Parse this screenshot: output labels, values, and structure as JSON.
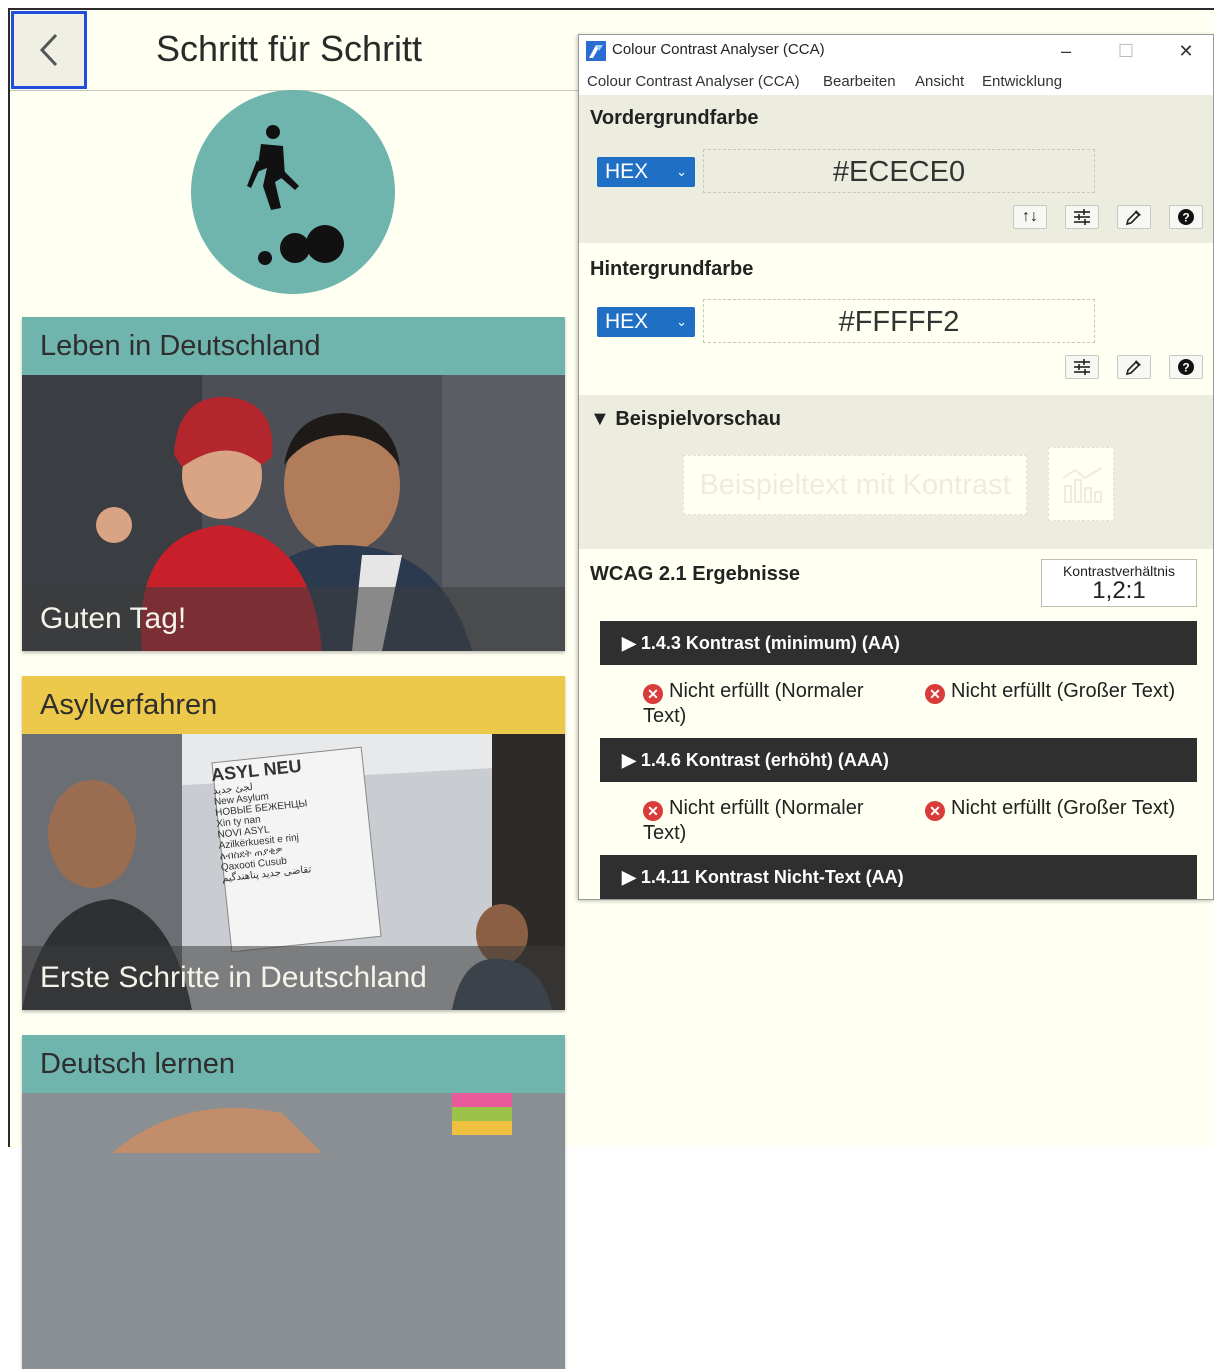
{
  "app": {
    "title": "Schritt für Schritt",
    "cards": [
      {
        "heading": "Leben in Deutschland",
        "caption": "Guten Tag!",
        "color": "#6fb5ad"
      },
      {
        "heading": "Asylverfahren",
        "caption": "Erste Schritte in Deutschland",
        "color": "#ecc94a"
      },
      {
        "heading": "Deutsch lernen",
        "caption": "",
        "color": "#6fb5ad"
      }
    ],
    "sign_lines": [
      "ASYL NEU",
      "لجئ جديد",
      "New Asylum",
      "НОВЫЕ БЕЖЕНЦЫ",
      "Xin ty nan",
      "NOVI ASYL",
      "Azilkërkuesit e rinj",
      "ለብስደት ጠያቂዎ",
      "Qaxooti Cusub",
      "تقاضی جدید پناهندگیم"
    ],
    "colors": {
      "background": "#fffff2",
      "teal": "#6fb5ad",
      "yellow": "#ecc94a",
      "focus": "#1f4fdc"
    }
  },
  "cca": {
    "window_title": "Colour Contrast Analyser (CCA)",
    "controls": {
      "minimize": "–",
      "maximize": "☐",
      "close": "✕"
    },
    "menu": [
      "Colour Contrast Analyser (CCA)",
      "Bearbeiten",
      "Ansicht",
      "Entwicklung"
    ],
    "foreground": {
      "title": "Vordergrundfarbe",
      "format": "HEX",
      "value": "#ECECE0"
    },
    "background": {
      "title": "Hintergrundfarbe",
      "format": "HEX",
      "value": "#FFFFF2"
    },
    "preview": {
      "title": "▼ Beispielvorschau",
      "sample_text": "Beispieltext mit Kontrast"
    },
    "results": {
      "title": "WCAG 2.1 Ergebnisse",
      "ratio_label": "Kontrastverhältnis",
      "ratio_value": "1,2:1",
      "criteria": [
        {
          "label": "▶ 1.4.3 Kontrast (minimum) (AA)",
          "normal": "Nicht erfüllt (Normaler Text)",
          "large": "Nicht erfüllt (Großer Text)"
        },
        {
          "label": "▶ 1.4.6 Kontrast (erhöht) (AAA)",
          "normal": "Nicht erfüllt (Normaler Text)",
          "large": "Nicht erfüllt (Großer Text)"
        },
        {
          "label": "▶ 1.4.11 Kontrast Nicht-Text (AA)"
        }
      ]
    },
    "colors": {
      "accent": "#1f6fc5",
      "fail": "#d93a3a",
      "section_dark": "#ececdf",
      "bar": "#2f2f2f"
    }
  }
}
